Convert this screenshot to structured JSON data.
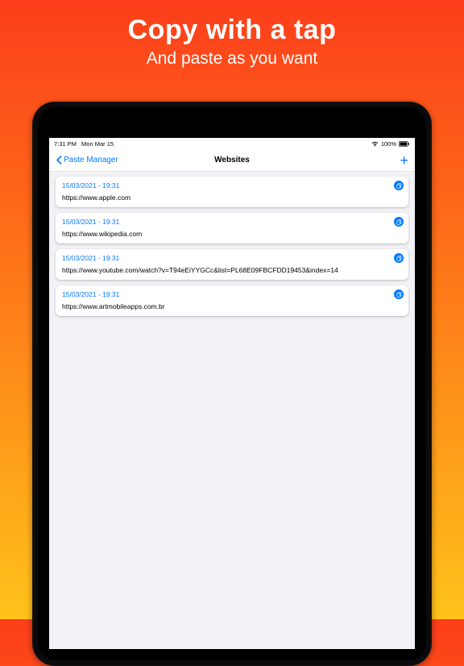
{
  "promo": {
    "title": "Copy with a tap",
    "subtitle": "And paste as you want"
  },
  "status": {
    "time": "7:31 PM",
    "date": "Mon Mar 15",
    "battery": "100%"
  },
  "nav": {
    "back_label": "Paste Manager",
    "title": "Websites"
  },
  "items": [
    {
      "timestamp": "15/03/2021 - 19:31",
      "url": "https://www.apple.com"
    },
    {
      "timestamp": "15/03/2021 - 19:31",
      "url": "https://www.wikipedia.com"
    },
    {
      "timestamp": "15/03/2021 - 19:31",
      "url": "https://www.youtube.com/watch?v=T94eEiYYGCc&list=PL68E09FBCFDD19453&index=14"
    },
    {
      "timestamp": "15/03/2021 - 19:31",
      "url": "https://www.artmobileapps.com.br"
    }
  ]
}
